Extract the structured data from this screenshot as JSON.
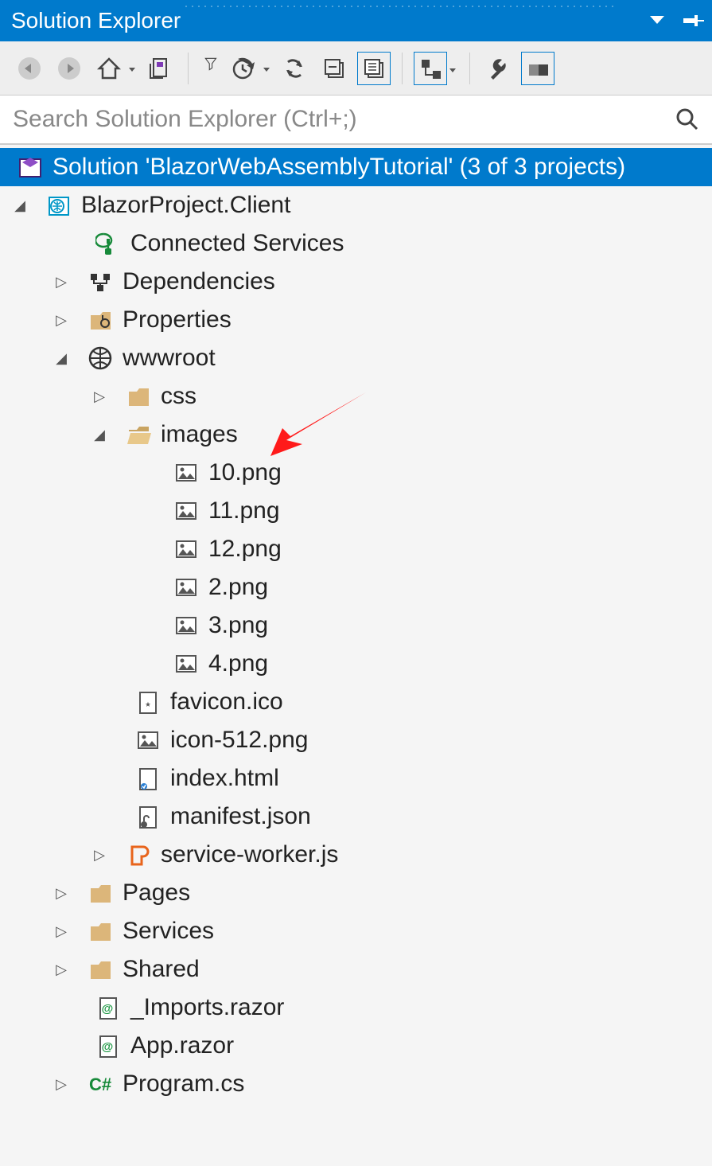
{
  "title": "Solution Explorer",
  "search": {
    "placeholder": "Search Solution Explorer (Ctrl+;)"
  },
  "solution": {
    "label": "Solution 'BlazorWebAssemblyTutorial' (3 of 3 projects)"
  },
  "project": {
    "name": "BlazorProject.Client",
    "connected_services": "Connected Services",
    "dependencies": "Dependencies",
    "properties": "Properties",
    "wwwroot": {
      "label": "wwwroot",
      "css": "css",
      "images": {
        "label": "images",
        "files": [
          "10.png",
          "11.png",
          "12.png",
          "2.png",
          "3.png",
          "4.png"
        ]
      },
      "favicon": "favicon.ico",
      "icon512": "icon-512.png",
      "index": "index.html",
      "manifest": "manifest.json",
      "sw": "service-worker.js"
    },
    "pages": "Pages",
    "services": "Services",
    "shared": "Shared",
    "imports": "_Imports.razor",
    "app_razor": "App.razor",
    "program": "Program.cs"
  }
}
